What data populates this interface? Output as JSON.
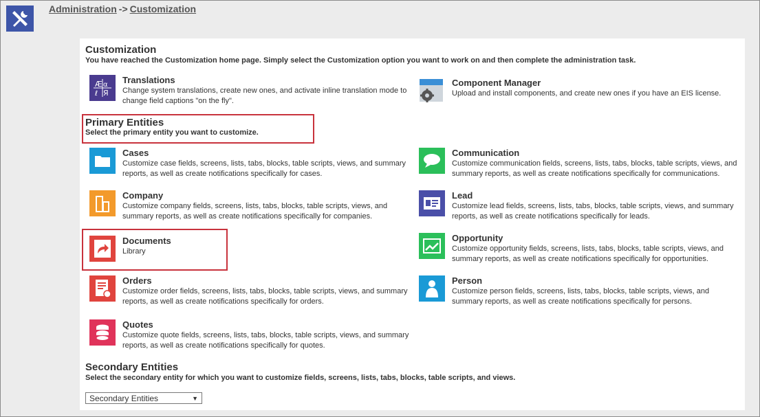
{
  "breadcrumb": {
    "root": "Administration",
    "separator": "->",
    "current": "Customization"
  },
  "customization": {
    "title": "Customization",
    "description": "You have reached the Customization home page. Simply select the Customization option you want to work on and then complete the administration task."
  },
  "tools": [
    {
      "title": "Translations",
      "desc": "Change system translations, create new ones, and activate inline translation mode to change field captions \"on the fly\".",
      "icon": "translations-icon",
      "color": "#4a3b8f"
    },
    {
      "title": "Component Manager",
      "desc": "Upload and install components, and create new ones if you have an EIS license.",
      "icon": "component-manager-icon",
      "color": "#3a8fd6"
    }
  ],
  "primary": {
    "title": "Primary Entities",
    "description": "Select the primary entity you want to customize.",
    "items": [
      {
        "title": "Cases",
        "desc": "Customize case fields, screens, lists, tabs, blocks, table scripts, views, and summary reports, as well as create notifications specifically for cases.",
        "icon": "folder-icon",
        "color": "#1a9ad6"
      },
      {
        "title": "Communication",
        "desc": "Customize communication fields, screens, lists, tabs, blocks, table scripts, views, and summary reports, as well as create notifications specifically for communications.",
        "icon": "speech-bubble-icon",
        "color": "#2bbf5a"
      },
      {
        "title": "Company",
        "desc": "Customize company fields, screens, lists, tabs, blocks, table scripts, views, and summary reports, as well as create notifications specifically for companies.",
        "icon": "building-icon",
        "color": "#f39a2b"
      },
      {
        "title": "Lead",
        "desc": "Customize lead fields, screens, lists, tabs, blocks, table scripts, views, and summary reports, as well as create notifications specifically for leads.",
        "icon": "id-card-icon",
        "color": "#4a4fa8"
      },
      {
        "title": "Documents",
        "desc": "Library",
        "icon": "document-share-icon",
        "color": "#e0443e"
      },
      {
        "title": "Opportunity",
        "desc": "Customize opportunity fields, screens, lists, tabs, blocks, table scripts, views, and summary reports, as well as create notifications specifically for opportunities.",
        "icon": "trend-chart-icon",
        "color": "#2bbf5a"
      },
      {
        "title": "Orders",
        "desc": "Customize order fields, screens, lists, tabs, blocks, table scripts, views, and summary reports, as well as create notifications specifically for orders.",
        "icon": "order-icon",
        "color": "#e0443e"
      },
      {
        "title": "Person",
        "desc": "Customize person fields, screens, lists, tabs, blocks, table scripts, views, and summary reports, as well as create notifications specifically for persons.",
        "icon": "person-icon",
        "color": "#1a9ad6"
      },
      {
        "title": "Quotes",
        "desc": "Customize quote fields, screens, lists, tabs, blocks, table scripts, views, and summary reports, as well as create notifications specifically for quotes.",
        "icon": "coins-icon",
        "color": "#e0335a"
      }
    ]
  },
  "secondary": {
    "title": "Secondary Entities",
    "description": "Select the secondary entity for which you want to customize fields, screens, lists, tabs, blocks, table scripts, and views.",
    "select_value": "Secondary Entities"
  },
  "colors": {
    "highlight": "#c8323c",
    "admin_icon_bg": "#3d55a8"
  }
}
